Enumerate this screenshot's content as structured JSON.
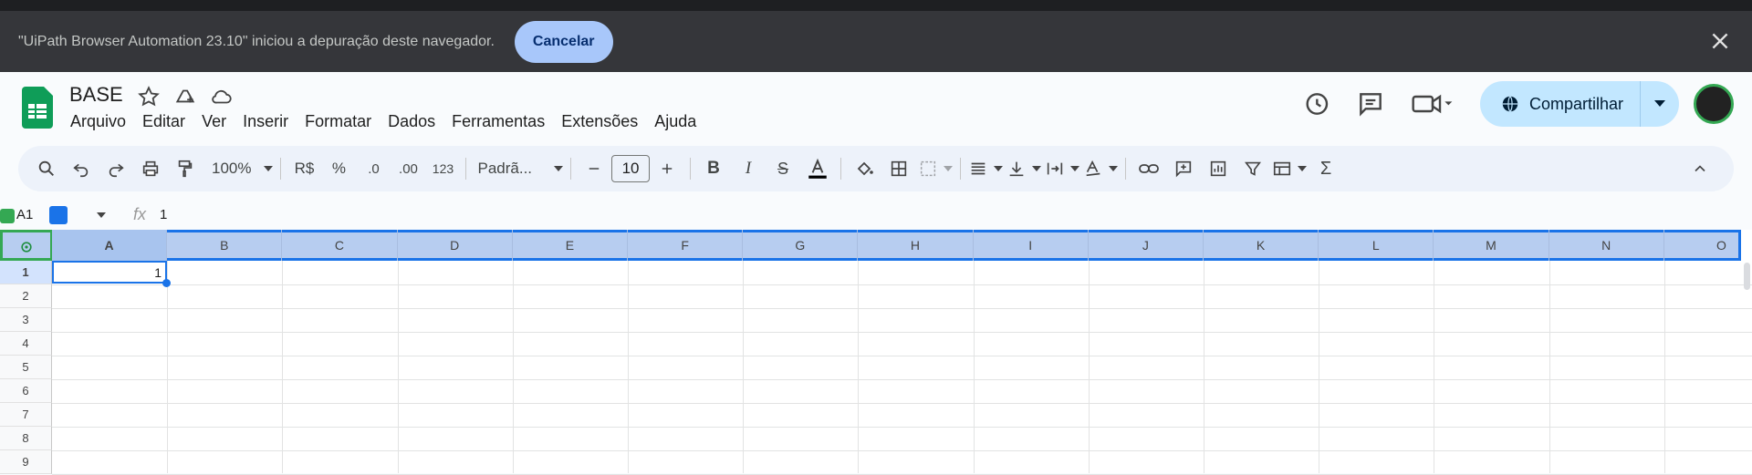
{
  "debug_banner": {
    "message": "\"UiPath Browser Automation 23.10\" iniciou a depuração deste navegador.",
    "cancel_label": "Cancelar"
  },
  "doc": {
    "title": "BASE"
  },
  "menu": [
    "Arquivo",
    "Editar",
    "Ver",
    "Inserir",
    "Formatar",
    "Dados",
    "Ferramentas",
    "Extensões",
    "Ajuda"
  ],
  "share": {
    "label": "Compartilhar"
  },
  "toolbar": {
    "zoom": "100%",
    "currency": "R$",
    "percent": "%",
    "dec_less": ".0",
    "dec_more": ".00",
    "number_format": "123",
    "font": "Padrã...",
    "font_size": "10"
  },
  "formula_bar": {
    "cell_ref": "A1",
    "fx": "fx",
    "value": "1"
  },
  "grid": {
    "columns": [
      "A",
      "B",
      "C",
      "D",
      "E",
      "F",
      "G",
      "H",
      "I",
      "J",
      "K",
      "L",
      "M",
      "N",
      "O"
    ],
    "rows": [
      "1",
      "2",
      "3",
      "4",
      "5",
      "6",
      "7",
      "8",
      "9"
    ],
    "a1_value": "1"
  },
  "colors": {
    "accent": "#1a73e8",
    "share_bg": "#c2e7ff",
    "debug_bg": "#35363a"
  }
}
